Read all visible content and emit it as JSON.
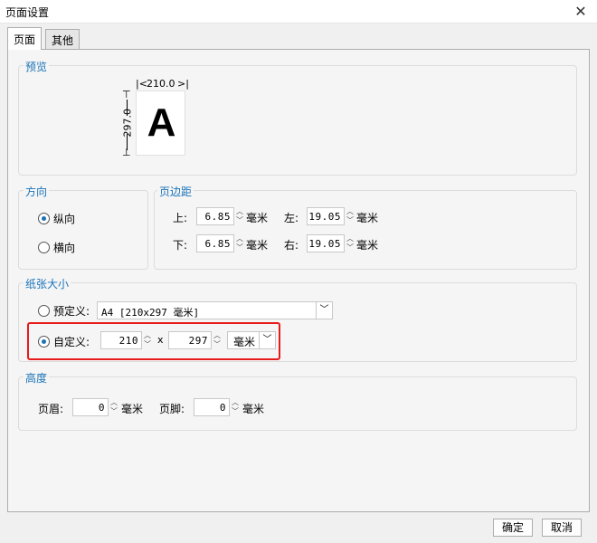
{
  "window": {
    "title": "页面设置",
    "close": "✕"
  },
  "tabs": [
    {
      "label": "页面"
    },
    {
      "label": "其他"
    }
  ],
  "preview": {
    "legend": "预览",
    "width_label": "210.0",
    "height_label": "297.0",
    "letter": "A"
  },
  "orientation": {
    "legend": "方向",
    "portrait": "纵向",
    "landscape": "横向",
    "selected": "纵向"
  },
  "margins": {
    "legend": "页边距",
    "top_label": "上:",
    "top_value": "6.85",
    "left_label": "左:",
    "left_value": "19.05",
    "bottom_label": "下:",
    "bottom_value": "6.85",
    "right_label": "右:",
    "right_value": "19.05",
    "unit": "毫米"
  },
  "paper": {
    "legend": "纸张大小",
    "predefined_label": "预定义:",
    "predefined_value": "A4 [210x297 毫米]",
    "custom_label": "自定义:",
    "custom_width": "210",
    "times": "x",
    "custom_height": "297",
    "unit_value": "毫米",
    "selected": "自定义"
  },
  "height": {
    "legend": "高度",
    "header_label": "页眉:",
    "header_value": "0",
    "footer_label": "页脚:",
    "footer_value": "0",
    "unit": "毫米"
  },
  "footer": {
    "ok": "确定",
    "cancel": "取消"
  },
  "colors": {
    "accent": "#1a73b8",
    "highlight": "#e81b1b"
  }
}
